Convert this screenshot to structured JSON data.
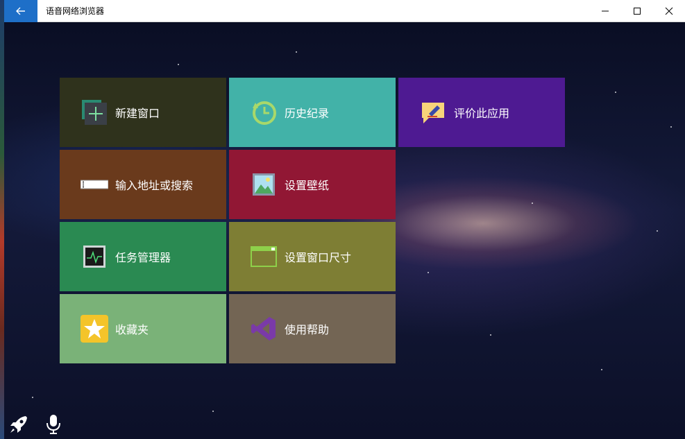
{
  "window": {
    "title": "语音网络浏览器"
  },
  "tiles": [
    {
      "label": "新建窗口",
      "color": "#2f321c",
      "icon": "new-window-icon"
    },
    {
      "label": "历史纪录",
      "color": "#42b2a8",
      "icon": "history-icon"
    },
    {
      "label": "评价此应用",
      "color": "#4e1a92",
      "icon": "rate-app-icon"
    },
    {
      "label": "输入地址或搜索",
      "color": "#6a3a1c",
      "icon": "address-bar-icon"
    },
    {
      "label": "设置壁纸",
      "color": "#911734",
      "icon": "wallpaper-icon"
    },
    {
      "label": "任务管理器",
      "color": "#2a8a52",
      "icon": "task-manager-icon"
    },
    {
      "label": "设置窗口尺寸",
      "color": "#7e7e34",
      "icon": "window-size-icon"
    },
    {
      "label": "收藏夹",
      "color": "#7ab278",
      "icon": "favorites-icon"
    },
    {
      "label": "使用帮助",
      "color": "#736554",
      "icon": "help-icon"
    }
  ],
  "bottom_icons": [
    "rocket-icon",
    "microphone-icon"
  ],
  "colors": {
    "accent": "#1e6fc8",
    "titlebar": "#ffffff"
  }
}
